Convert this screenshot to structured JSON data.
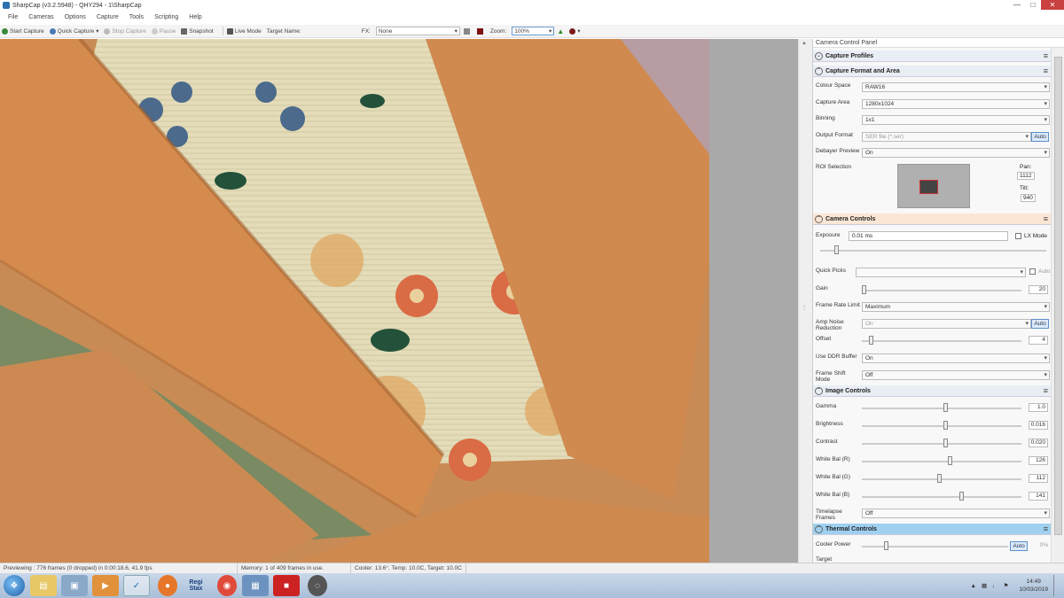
{
  "window": {
    "title": "SharpCap (v3.2.5948) - QHY294 - 1\\SharpCap",
    "btn_min": "—",
    "btn_max": "□",
    "btn_close": "✕"
  },
  "menu": [
    "File",
    "Cameras",
    "Options",
    "Capture",
    "Tools",
    "Scripting",
    "Help"
  ],
  "toolbar": {
    "start_capture": "Start Capture",
    "quick_capture": "Quick Capture",
    "stop_capture": "Stop Capture",
    "pause": "Pause",
    "snapshot": "Snapshot",
    "live_mode": "Live Mode",
    "target_name": "Target Name:",
    "fx_label": "FX:",
    "fx_value": "None",
    "zoom_label": "Zoom:",
    "zoom_value": "100%"
  },
  "panel": {
    "title": "Camera Control Panel",
    "sections": {
      "capture_profiles": "Capture Profiles",
      "capture_format": "Capture Format and Area",
      "camera_controls": "Camera Controls",
      "image_controls": "Image Controls",
      "thermal_controls": "Thermal Controls"
    },
    "format": {
      "colour_space_label": "Colour Space",
      "colour_space": "RAW16",
      "capture_area_label": "Capture Area",
      "capture_area": "1280x1024",
      "binning_label": "Binning",
      "binning": "1x1",
      "output_format_label": "Output Format",
      "output_format": "SER file (*.ser)",
      "output_auto": "Auto",
      "debayer_label": "Debayer Preview",
      "debayer": "On",
      "roi_label": "ROI Selection",
      "pan_label": "Pan:",
      "pan_value": "1112",
      "tilt_label": "Tilt:",
      "tilt_value": "940"
    },
    "camera": {
      "exposure_label": "Exposure",
      "exposure_value": "0.01 ms",
      "lx_mode": "LX Mode",
      "quick_picks_label": "Quick Picks",
      "quick_picks_auto": "Auto",
      "gain_label": "Gain",
      "gain_value": "20",
      "frame_rate_label": "Frame Rate Limit",
      "frame_rate": "Maximum",
      "amp_noise_label": "Amp Noise Reduction",
      "amp_noise": "On",
      "amp_auto": "Auto",
      "offset_label": "Offset",
      "offset_value": "4",
      "ddr_label": "Use DDR Buffer",
      "ddr_value": "On",
      "frame_shift_label": "Frame Shift Mode",
      "frame_shift_value": "Off"
    },
    "image": {
      "gamma_label": "Gamma",
      "gamma_value": "1.0",
      "brightness_label": "Brightness",
      "brightness_value": "0.016",
      "contrast_label": "Contrast",
      "contrast_value": "0.020",
      "wb_r_label": "White Bal (R)",
      "wb_r_value": "126",
      "wb_g_label": "White Bal (G)",
      "wb_g_value": "112",
      "wb_b_label": "White Bal (B)",
      "wb_b_value": "141",
      "timelapse_label": "Timelapse Frames",
      "timelapse_value": "Off"
    },
    "thermal": {
      "cooler_power_label": "Cooler Power",
      "cooler_auto": "Auto",
      "cooler_value": "0%",
      "target_label": "Target"
    }
  },
  "status": {
    "previewing": "Previewing : 776 frames (0 dropped) in 0:00:18.6, 41.9 fps",
    "memory": "Memory: 1 of 409 frames in use.",
    "cooler": "Cooler: 13.6°, Temp: 10.0C, Target: 10.0C"
  },
  "taskbar": {
    "time": "14:49",
    "date": "10/03/2019",
    "regi_label": "Regi Stax"
  }
}
